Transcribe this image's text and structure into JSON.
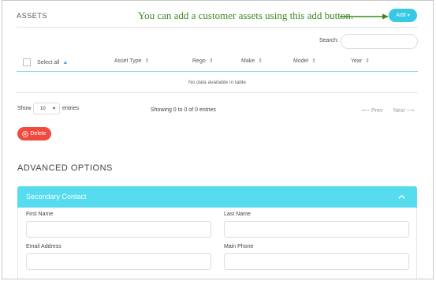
{
  "assets": {
    "title": "ASSETS",
    "annotation": "You can add a customer assets using this add button.",
    "add_label": "Add",
    "search_label": "Search:",
    "search_value": ""
  },
  "table": {
    "select_all": "Select all",
    "columns": [
      "Asset Type",
      "Rego",
      "Make",
      "Model",
      "Year"
    ],
    "empty_message": "No data available in table"
  },
  "pagination": {
    "show": "Show",
    "page_size": "10",
    "entries": "entries",
    "info": "Showing 0 to 0 of 0 entries",
    "prev": "Prev",
    "next": "Next"
  },
  "actions": {
    "delete_label": "Delete"
  },
  "advanced": {
    "title": "ADVANCED OPTIONS",
    "panel_title": "Secondary Contact",
    "fields": {
      "first_name": {
        "label": "First Name",
        "value": ""
      },
      "last_name": {
        "label": "Last Name",
        "value": ""
      },
      "email": {
        "label": "Email Address",
        "value": ""
      },
      "phone": {
        "label": "Main Phone",
        "value": ""
      }
    }
  },
  "colors": {
    "accent": "#35c9e4",
    "panel": "#56dbef",
    "danger": "#f04b3f",
    "annotation": "#3a8a1e"
  },
  "icons": [
    "sort-icon",
    "sort-up-icon",
    "caret-down-icon",
    "x-circle-icon",
    "chevron-up-icon",
    "arrow-left-icon",
    "arrow-right-icon",
    "annotation-arrow-icon"
  ]
}
